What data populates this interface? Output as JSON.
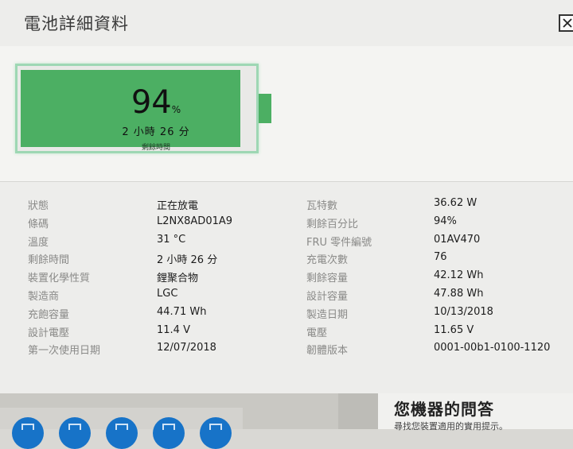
{
  "window": {
    "title": "電池詳細資料"
  },
  "battery": {
    "percent": "94",
    "percent_unit": "%",
    "charge_fraction": 0.94,
    "time_remaining": "2 小時 26 分",
    "time_label": "剩餘時間",
    "fill_color": "#4caf63",
    "outline_color": "#9ed7b4"
  },
  "details": {
    "left": [
      {
        "label": "狀態",
        "value": "正在放電"
      },
      {
        "label": "條碼",
        "value": "L2NX8AD01A9"
      },
      {
        "label": "溫度",
        "value": "31 °C"
      },
      {
        "label": "剩餘時間",
        "value": "2 小時 26 分"
      },
      {
        "label": "裝置化學性質",
        "value": "鋰聚合物"
      },
      {
        "label": "製造商",
        "value": "LGC"
      },
      {
        "label": "充飽容量",
        "value": "44.71 Wh"
      },
      {
        "label": "設計電壓",
        "value": "11.4 V"
      },
      {
        "label": "第一次使用日期",
        "value": "12/07/2018"
      }
    ],
    "right": [
      {
        "label": "瓦特數",
        "value": "36.62 W"
      },
      {
        "label": "剩餘百分比",
        "value": "94%"
      },
      {
        "label": "FRU 零件編號",
        "value": "01AV470"
      },
      {
        "label": "充電次數",
        "value": "76"
      },
      {
        "label": "剩餘容量",
        "value": "42.12 Wh"
      },
      {
        "label": "設計容量",
        "value": "47.88 Wh"
      },
      {
        "label": "製造日期",
        "value": "10/13/2018"
      },
      {
        "label": "電壓",
        "value": "11.65 V"
      },
      {
        "label": "韌體版本",
        "value": "0001-00b1-0100-1120"
      }
    ]
  },
  "background": {
    "qa_title": "您機器的問答",
    "qa_subtitle": "尋找您裝置適用的實用提示。",
    "button_color": "#1773c8"
  }
}
